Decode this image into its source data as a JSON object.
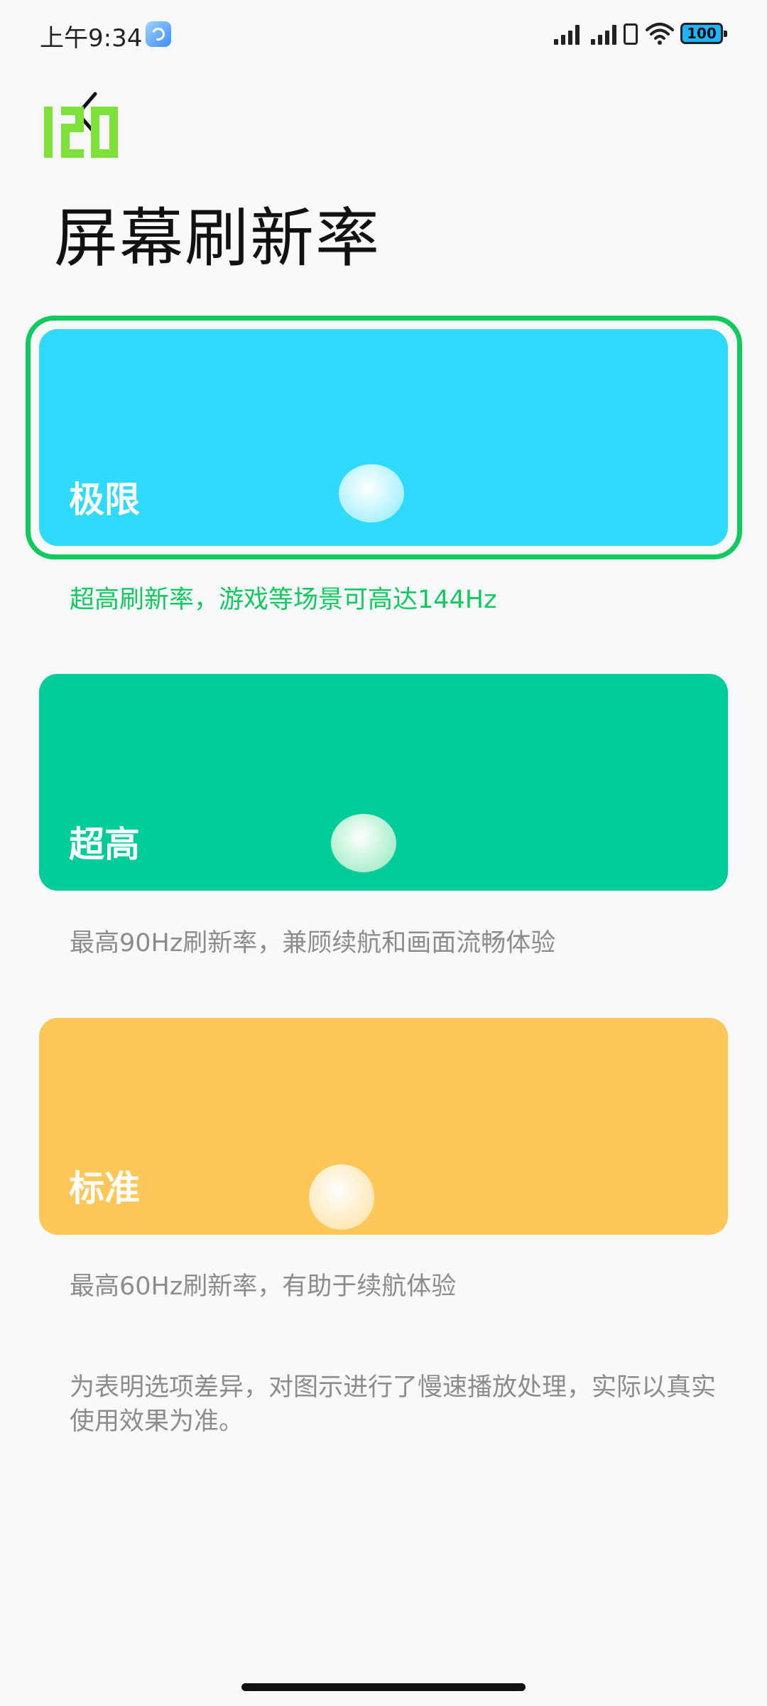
{
  "status_bar": {
    "time": "上午9:34",
    "battery": "100",
    "icons": [
      "app-notification-icon",
      "signal-icon",
      "signal-icon",
      "sim-card-icon",
      "wifi-icon",
      "battery-icon"
    ]
  },
  "header": {
    "back_icon": "back-arrow-icon",
    "logo_text": "120",
    "title": "屏幕刷新率"
  },
  "options": [
    {
      "label": "极限",
      "description": "超高刷新率，游戏等场景可高达144Hz",
      "color": "#2fd9ff",
      "selected": true
    },
    {
      "label": "超高",
      "description": "最高90Hz刷新率，兼顾续航和画面流畅体验",
      "color": "#00cc99",
      "selected": false
    },
    {
      "label": "标准",
      "description": "最高60Hz刷新率，有助于续航体验",
      "color": "#ffc75a",
      "selected": false
    }
  ],
  "footnote": "为表明选项差异，对图示进行了慢速播放处理，实际以真实使用效果为准。",
  "colors": {
    "accent": "#12c95e",
    "background": "#f8f9fb"
  }
}
